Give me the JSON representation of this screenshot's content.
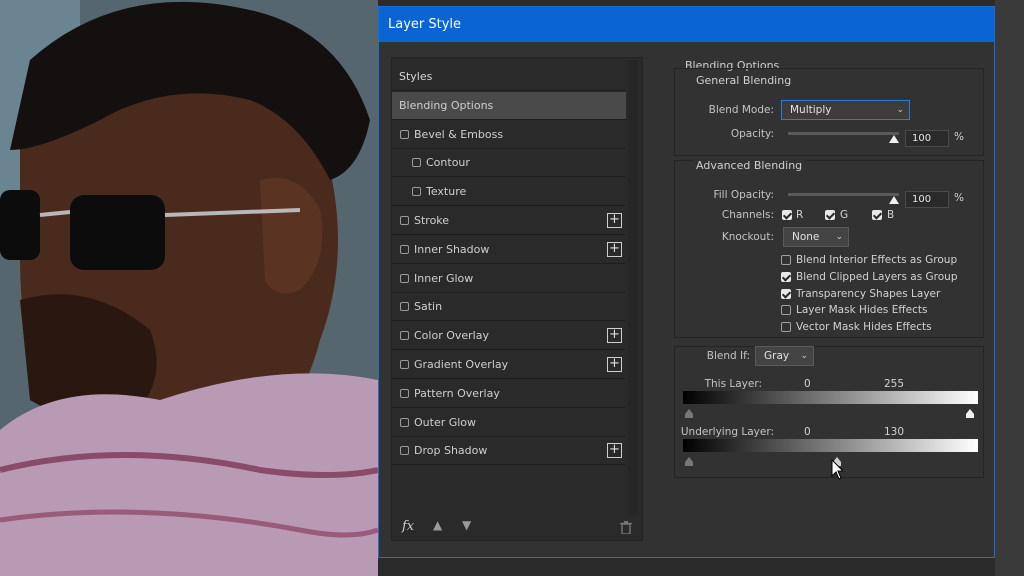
{
  "dialog": {
    "title": "Layer Style"
  },
  "styles_panel": {
    "items": [
      {
        "label": "Styles",
        "checkbox": false,
        "plus": false,
        "header": true,
        "selected": false,
        "indent": 0
      },
      {
        "label": "Blending Options",
        "checkbox": false,
        "plus": false,
        "header": false,
        "selected": true,
        "indent": 0
      },
      {
        "label": "Bevel & Emboss",
        "checkbox": true,
        "checked": false,
        "plus": false,
        "indent": 0
      },
      {
        "label": "Contour",
        "checkbox": true,
        "checked": false,
        "plus": false,
        "indent": 1
      },
      {
        "label": "Texture",
        "checkbox": true,
        "checked": false,
        "plus": false,
        "indent": 1
      },
      {
        "label": "Stroke",
        "checkbox": true,
        "checked": false,
        "plus": true,
        "indent": 0
      },
      {
        "label": "Inner Shadow",
        "checkbox": true,
        "checked": false,
        "plus": true,
        "indent": 0
      },
      {
        "label": "Inner Glow",
        "checkbox": true,
        "checked": false,
        "plus": false,
        "indent": 0
      },
      {
        "label": "Satin",
        "checkbox": true,
        "checked": false,
        "plus": false,
        "indent": 0
      },
      {
        "label": "Color Overlay",
        "checkbox": true,
        "checked": false,
        "plus": true,
        "indent": 0
      },
      {
        "label": "Gradient Overlay",
        "checkbox": true,
        "checked": false,
        "plus": true,
        "indent": 0
      },
      {
        "label": "Pattern Overlay",
        "checkbox": true,
        "checked": false,
        "plus": false,
        "indent": 0
      },
      {
        "label": "Outer Glow",
        "checkbox": true,
        "checked": false,
        "plus": false,
        "indent": 0
      },
      {
        "label": "Drop Shadow",
        "checkbox": true,
        "checked": false,
        "plus": true,
        "indent": 0
      }
    ],
    "fx_label": "fx"
  },
  "blending_options": {
    "title": "Blending Options",
    "general": {
      "title": "General Blending",
      "blend_mode_label": "Blend Mode:",
      "blend_mode_value": "Multiply",
      "opacity_label": "Opacity:",
      "opacity_value": "100",
      "opacity_unit": "%"
    },
    "advanced": {
      "title": "Advanced Blending",
      "fill_opacity_label": "Fill Opacity:",
      "fill_opacity_value": "100",
      "fill_opacity_unit": "%",
      "channels_label": "Channels:",
      "channels": [
        {
          "label": "R",
          "checked": true
        },
        {
          "label": "G",
          "checked": true
        },
        {
          "label": "B",
          "checked": true
        }
      ],
      "knockout_label": "Knockout:",
      "knockout_value": "None",
      "options": [
        {
          "label": "Blend Interior Effects as Group",
          "checked": false
        },
        {
          "label": "Blend Clipped Layers as Group",
          "checked": true
        },
        {
          "label": "Transparency Shapes Layer",
          "checked": true
        },
        {
          "label": "Layer Mask Hides Effects",
          "checked": false
        },
        {
          "label": "Vector Mask Hides Effects",
          "checked": false
        }
      ]
    },
    "blend_if": {
      "label": "Blend If:",
      "value": "Gray",
      "this_layer_label": "This Layer:",
      "this_layer_low": "0",
      "this_layer_high": "255",
      "underlying_label": "Underlying Layer:",
      "underlying_low": "0",
      "underlying_high": "130"
    }
  },
  "colors": {
    "titlebar": "#0a64d4",
    "dialog_bg": "#323232",
    "panel_bg": "#2a2a2a",
    "selected_row": "#4a4a4a"
  }
}
